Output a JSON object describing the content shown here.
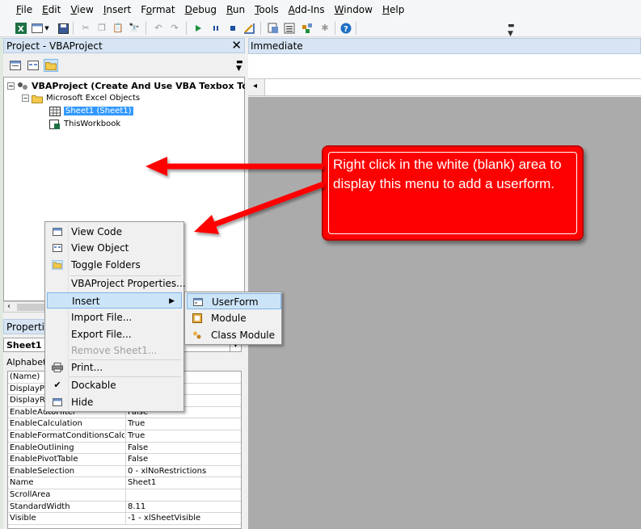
{
  "menubar": {
    "items": [
      {
        "label": "File",
        "key": "F",
        "rest": "ile"
      },
      {
        "label": "Edit",
        "key": "E",
        "rest": "dit"
      },
      {
        "label": "View",
        "key": "V",
        "rest": "iew"
      },
      {
        "label": "Insert",
        "key": "I",
        "rest": "nsert"
      },
      {
        "label": "Format",
        "key": "o",
        "pre": "F",
        "rest": "rmat"
      },
      {
        "label": "Debug",
        "key": "D",
        "rest": "ebug"
      },
      {
        "label": "Run",
        "key": "R",
        "rest": "un"
      },
      {
        "label": "Tools",
        "key": "T",
        "rest": "ools"
      },
      {
        "label": "Add-Ins",
        "key": "A",
        "rest": "dd-Ins"
      },
      {
        "label": "Window",
        "key": "W",
        "rest": "indow"
      },
      {
        "label": "Help",
        "key": "H",
        "rest": "elp"
      }
    ]
  },
  "project": {
    "title": "Project - VBAProject",
    "close": "✕",
    "root": "VBAProject (Create And Use VBA Texbox To Enter D",
    "folder": "Microsoft Excel Objects",
    "sheet": "Sheet1 (Sheet1)",
    "workbook": "ThisWorkbook"
  },
  "properties": {
    "title": "Properties",
    "object": "Sheet1",
    "object_suffix": "W",
    "tab": "Alphabetic",
    "rows": [
      {
        "name": "(Name)",
        "value": ""
      },
      {
        "name": "DisplayPageBreaks",
        "value": ""
      },
      {
        "name": "DisplayRightToLeft",
        "value": ""
      },
      {
        "name": "EnableAutoFilter",
        "value": "False"
      },
      {
        "name": "EnableCalculation",
        "value": "True"
      },
      {
        "name": "EnableFormatConditionsCalculation",
        "value": "True"
      },
      {
        "name": "EnableOutlining",
        "value": "False"
      },
      {
        "name": "EnablePivotTable",
        "value": "False"
      },
      {
        "name": "EnableSelection",
        "value": "0 - xlNoRestrictions"
      },
      {
        "name": "Name",
        "value": "Sheet1"
      },
      {
        "name": "ScrollArea",
        "value": ""
      },
      {
        "name": "StandardWidth",
        "value": "8.11"
      },
      {
        "name": "Visible",
        "value": "-1 - xlSheetVisible"
      }
    ]
  },
  "immediate": {
    "title": "Immediate"
  },
  "context_menu": {
    "items": [
      {
        "label": "View Code"
      },
      {
        "label": "View Object"
      },
      {
        "label": "Toggle Folders"
      },
      {
        "label": "VBAProject Properties..."
      },
      {
        "label": "Insert"
      },
      {
        "label": "Import File..."
      },
      {
        "label": "Export File..."
      },
      {
        "label": "Remove Sheet1..."
      },
      {
        "label": "Print..."
      },
      {
        "label": "Dockable"
      },
      {
        "label": "Hide"
      }
    ]
  },
  "submenu": {
    "items": [
      {
        "label": "UserForm"
      },
      {
        "label": "Module"
      },
      {
        "label": "Class Module"
      }
    ]
  },
  "callout": {
    "text": "Right click in the white (blank) area to display this menu to add a userform."
  },
  "colors": {
    "callout": "#ff0000",
    "selection": "#3399ff",
    "hover": "#cce4f7",
    "mdi_background": "#ababab"
  }
}
